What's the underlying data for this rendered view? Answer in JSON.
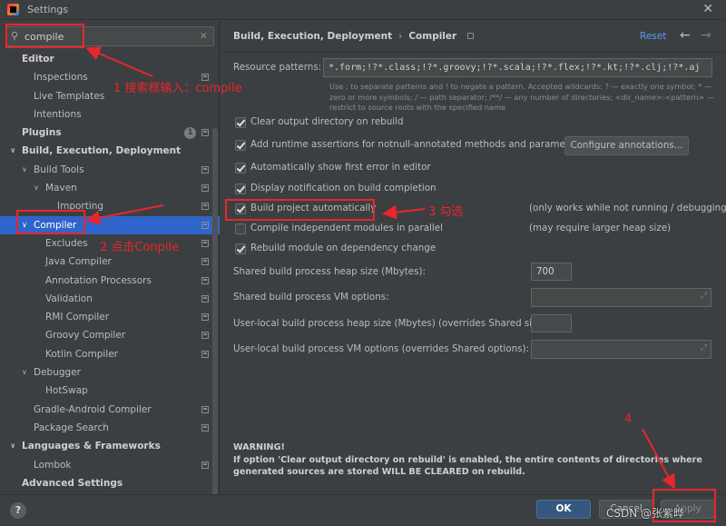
{
  "window": {
    "title": "Settings",
    "close_glyph": "✕",
    "icon": "intellij-icon"
  },
  "search": {
    "value": "compile",
    "icon": "search-icon",
    "clear_glyph": "✕"
  },
  "tree": [
    {
      "label": "Editor",
      "bold": true,
      "chevron": "",
      "project": false,
      "badge": ""
    },
    {
      "label": "Inspections",
      "bold": false,
      "chevron": "",
      "project": true,
      "badge": ""
    },
    {
      "label": "Live Templates",
      "bold": false,
      "chevron": "",
      "project": false,
      "badge": ""
    },
    {
      "label": "Intentions",
      "bold": false,
      "chevron": "",
      "project": false,
      "badge": ""
    },
    {
      "label": "Plugins",
      "bold": true,
      "chevron": "",
      "project": true,
      "badge": "1"
    },
    {
      "label": "Build, Execution, Deployment",
      "bold": true,
      "chevron": "∨",
      "project": false,
      "badge": ""
    },
    {
      "label": "Build Tools",
      "bold": false,
      "chevron": "∨",
      "project": true,
      "badge": ""
    },
    {
      "label": "Maven",
      "bold": false,
      "chevron": "∨",
      "project": true,
      "badge": ""
    },
    {
      "label": "Importing",
      "bold": false,
      "chevron": "",
      "project": true,
      "badge": ""
    },
    {
      "label": "Compiler",
      "bold": false,
      "chevron": "∨",
      "project": true,
      "badge": "",
      "selected": true
    },
    {
      "label": "Excludes",
      "bold": false,
      "chevron": "",
      "project": true,
      "badge": ""
    },
    {
      "label": "Java Compiler",
      "bold": false,
      "chevron": "",
      "project": true,
      "badge": ""
    },
    {
      "label": "Annotation Processors",
      "bold": false,
      "chevron": "",
      "project": true,
      "badge": ""
    },
    {
      "label": "Validation",
      "bold": false,
      "chevron": "",
      "project": true,
      "badge": ""
    },
    {
      "label": "RMI Compiler",
      "bold": false,
      "chevron": "",
      "project": true,
      "badge": ""
    },
    {
      "label": "Groovy Compiler",
      "bold": false,
      "chevron": "",
      "project": true,
      "badge": ""
    },
    {
      "label": "Kotlin Compiler",
      "bold": false,
      "chevron": "",
      "project": true,
      "badge": ""
    },
    {
      "label": "Debugger",
      "bold": false,
      "chevron": "∨",
      "project": false,
      "badge": ""
    },
    {
      "label": "HotSwap",
      "bold": false,
      "chevron": "",
      "project": false,
      "badge": ""
    },
    {
      "label": "Gradle-Android Compiler",
      "bold": false,
      "chevron": "",
      "project": true,
      "badge": ""
    },
    {
      "label": "Package Search",
      "bold": false,
      "chevron": "",
      "project": true,
      "badge": ""
    },
    {
      "label": "Languages & Frameworks",
      "bold": true,
      "chevron": "∨",
      "project": false,
      "badge": ""
    },
    {
      "label": "Lombok",
      "bold": false,
      "chevron": "",
      "project": true,
      "badge": ""
    },
    {
      "label": "Advanced Settings",
      "bold": true,
      "chevron": "",
      "project": false,
      "badge": ""
    }
  ],
  "header": {
    "crumb_parent": "Build, Execution, Deployment",
    "crumb_sep": "›",
    "crumb_current": "Compiler",
    "reset": "Reset",
    "back_glyph": "←",
    "forward_glyph": "→"
  },
  "resource": {
    "label": "Resource patterns:",
    "value": "*.form;!?*.class;!?*.groovy;!?*.scala;!?*.flex;!?*.kt;!?*.clj;!?*.aj",
    "hint": "Use ; to separate patterns and ! to negate a pattern. Accepted wildcards: ? — exactly one symbol; * — zero or more symbols; / — path separator; /**/ — any number of directories; <dir_name>:<pattern> — restrict to source roots with the specified name"
  },
  "options": [
    {
      "label": "Clear output directory on rebuild",
      "checked": true
    },
    {
      "label": "Add runtime assertions for notnull-annotated methods and parameters",
      "checked": true
    },
    {
      "label": "Automatically show first error in editor",
      "checked": true
    },
    {
      "label": "Display notification on build completion",
      "checked": true
    },
    {
      "label": "Build project automatically",
      "checked": true,
      "note": "(only works while not running / debugging)"
    },
    {
      "label": "Compile independent modules in parallel",
      "checked": false,
      "note": "(may require larger heap size)"
    },
    {
      "label": "Rebuild module on dependency change",
      "checked": true
    }
  ],
  "configure_button": "Configure annotations...",
  "fields": {
    "heap_label": "Shared build process heap size (Mbytes):",
    "heap_value": "700",
    "vm_label": "Shared build process VM options:",
    "vm_value": "",
    "user_heap_label": "User-local build process heap size (Mbytes) (overrides Shared size):",
    "user_heap_value": "",
    "user_vm_label": "User-local build process VM options (overrides Shared options):",
    "user_vm_value": "",
    "expand_glyph": "⤢"
  },
  "warning": {
    "title": "WARNING!",
    "body": "If option 'Clear output directory on rebuild' is enabled, the entire contents of directories where generated sources are stored WILL BE CLEARED on rebuild."
  },
  "footer": {
    "help": "?",
    "ok": "OK",
    "cancel": "Cancel",
    "apply": "Apply"
  },
  "annotations": {
    "step1": "1 搜索框输入：compile",
    "step2": "2 点击Conpile",
    "step3": "3 勾选",
    "step4": "4",
    "color": "#e8262d"
  },
  "watermark": "CSDN @张紫晔"
}
